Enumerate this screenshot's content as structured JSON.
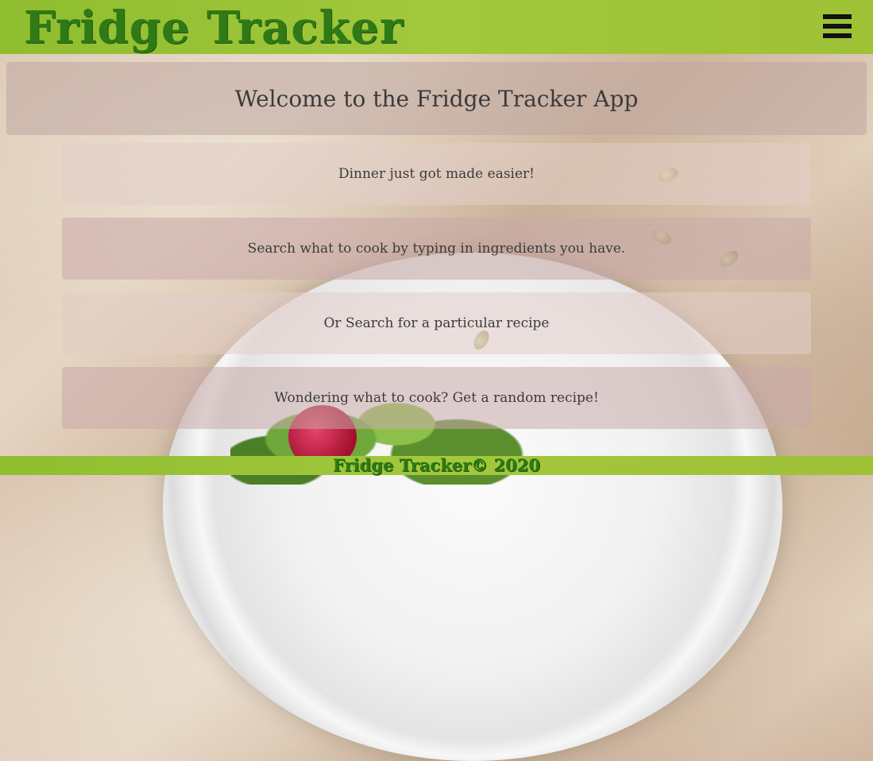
{
  "header": {
    "brand": "Fridge Tracker",
    "menu_icon": "hamburger-menu-icon"
  },
  "main": {
    "title": "Welcome to the Fridge Tracker App",
    "items": [
      "Dinner just got made easier!",
      "Search what to cook by typing in ingredients you have.",
      "Or Search for a particular recipe",
      "Wondering what to cook? Get a random recipe!"
    ]
  },
  "footer": {
    "text": "Fridge Tracker© 2020"
  },
  "colors": {
    "bar_green": "#9ec136",
    "brand_green": "#2f7a16"
  }
}
